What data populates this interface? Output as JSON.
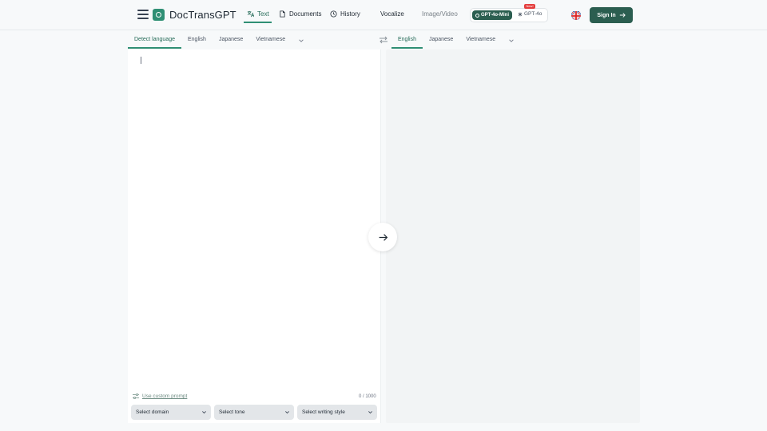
{
  "header": {
    "brand": "DocTransGPT",
    "nav": {
      "text": "Text",
      "documents": "Documents",
      "history": "History",
      "vocalize": "Vocalize",
      "image_video": "Image/Video"
    },
    "models": {
      "mini": "GPT-4o-Mini",
      "full": "GPT-4o",
      "new_badge": "New!"
    },
    "signin": "Sign In"
  },
  "source_langs": [
    "Detect language",
    "English",
    "Japanese",
    "Vietnamese"
  ],
  "target_langs": [
    "English",
    "Japanese",
    "Vietnamese"
  ],
  "editor": {
    "custom_prompt": "Use custom prompt",
    "char_count": "0 / 1000"
  },
  "selects": {
    "domain": "Select domain",
    "tone": "Select tone",
    "style": "Select writing style"
  },
  "colors": {
    "accent": "#2f8f74",
    "primary_button": "#2b5e50",
    "new_badge": "#e43d3d"
  }
}
